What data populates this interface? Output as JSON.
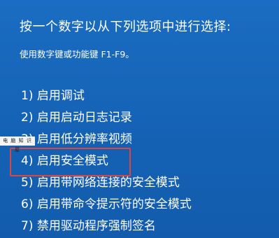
{
  "header": {
    "prompt": "按一个数字以从下列选项中进行选择:",
    "hint": "使用数字键或功能键 F1-F9。"
  },
  "options": [
    {
      "number": "1)",
      "label": "启用调试"
    },
    {
      "number": "2)",
      "label": "启用启动日志记录"
    },
    {
      "number": "3)",
      "label": "启用低分辨率视频"
    },
    {
      "number": "4)",
      "label": "启用安全模式"
    },
    {
      "number": "5)",
      "label": "启用带网络连接的安全模式"
    },
    {
      "number": "6)",
      "label": "启用带命令提示符的安全模式"
    },
    {
      "number": "7)",
      "label": "禁用驱动程序强制签名"
    }
  ],
  "selected_option": "4)",
  "watermark": "电 脑 知 识 屋",
  "colors": {
    "background": "#1565b8",
    "text": "#ffffff",
    "highlight_border": "#d9473f"
  }
}
